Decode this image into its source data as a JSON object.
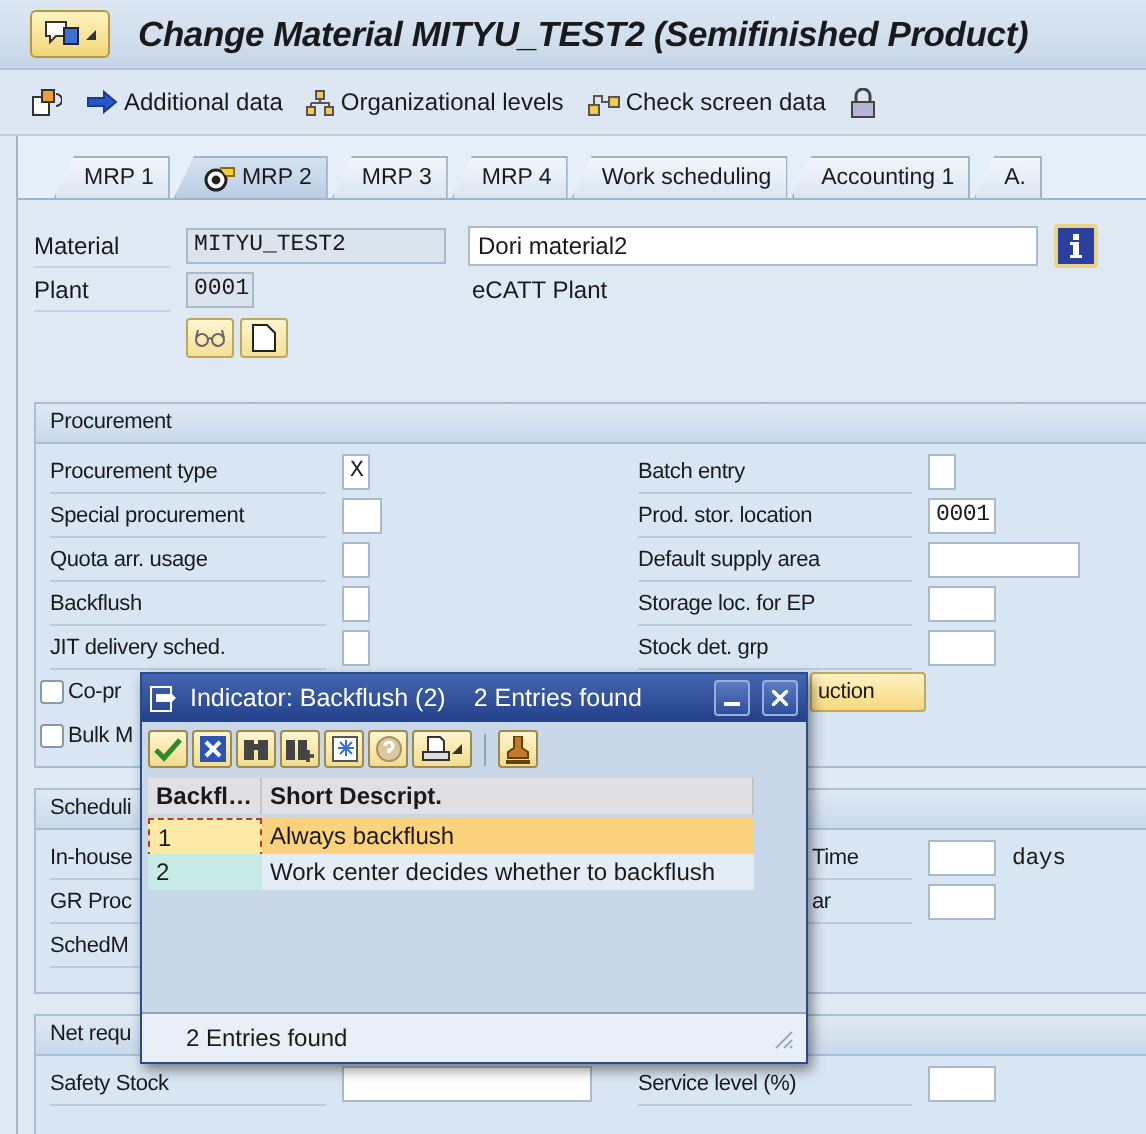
{
  "window": {
    "title": "Change Material MITYU_TEST2 (Semifinished Product)"
  },
  "toolbar": [
    {
      "label": "Additional data"
    },
    {
      "label": "Organizational levels"
    },
    {
      "label": "Check screen data"
    }
  ],
  "tabs": [
    {
      "label": "MRP 1",
      "selected": false
    },
    {
      "label": "MRP 2",
      "selected": true
    },
    {
      "label": "MRP 3",
      "selected": false
    },
    {
      "label": "MRP 4",
      "selected": false
    },
    {
      "label": "Work scheduling",
      "selected": false
    },
    {
      "label": "Accounting 1",
      "selected": false
    },
    {
      "label": "A.",
      "selected": false
    }
  ],
  "header": {
    "material": {
      "label": "Material",
      "value": "MITYU_TEST2",
      "description": "Dori material2"
    },
    "plant": {
      "label": "Plant",
      "value": "0001",
      "description": "eCATT Plant"
    }
  },
  "sections": [
    {
      "title": "Procurement",
      "rows": [
        {
          "left": {
            "kind": "char",
            "label": "Procurement type",
            "value": "X"
          },
          "right": {
            "kind": "char",
            "label": "Batch entry"
          }
        },
        {
          "left": {
            "kind": "short",
            "label": "Special procurement"
          },
          "right": {
            "kind": "code",
            "label": "Prod. stor. location",
            "value": "0001"
          }
        },
        {
          "left": {
            "kind": "char",
            "label": "Quota arr. usage"
          },
          "right": {
            "kind": "medium",
            "label": "Default supply area"
          }
        },
        {
          "left": {
            "kind": "char",
            "label": "Backflush"
          },
          "right": {
            "kind": "code",
            "label": "Storage loc. for EP"
          }
        },
        {
          "left": {
            "kind": "char",
            "label": "JIT delivery sched."
          },
          "right": {
            "kind": "code",
            "label": "Stock det. grp"
          }
        },
        {
          "left": {
            "kind": "checkbox",
            "label": "Co-pr",
            "checked": false
          },
          "right": {
            "kind": "button",
            "label": "uction"
          }
        },
        {
          "left": {
            "kind": "checkbox",
            "label": "Bulk M",
            "checked": false
          }
        }
      ]
    },
    {
      "title": "Scheduli",
      "rows": [
        {
          "left": {
            "kind": "label",
            "label": "In-house"
          },
          "right": {
            "kind": "code",
            "label": "Time",
            "partial": true,
            "unit": "days"
          }
        },
        {
          "left": {
            "kind": "label",
            "label": "GR Proc"
          },
          "right": {
            "kind": "code",
            "label": "ar",
            "partial": true
          }
        },
        {
          "left": {
            "kind": "label",
            "label": "SchedM"
          }
        }
      ]
    },
    {
      "title": "Net requ",
      "rows": [
        {
          "left": {
            "kind": "long",
            "label": "Safety Stock"
          },
          "right": {
            "kind": "code",
            "label": "Service level (%)"
          }
        }
      ]
    }
  ],
  "dialog": {
    "title": "Indicator: Backflush (2)",
    "count": "2 Entries found",
    "columns": [
      "Backfl…",
      "Short Descript."
    ],
    "rows": [
      {
        "cells": [
          "1",
          "Always backflush"
        ],
        "selected": true
      },
      {
        "cells": [
          "2",
          "Work center decides whether to backflush"
        ],
        "selected": false
      }
    ],
    "status": "2 Entries found"
  }
}
